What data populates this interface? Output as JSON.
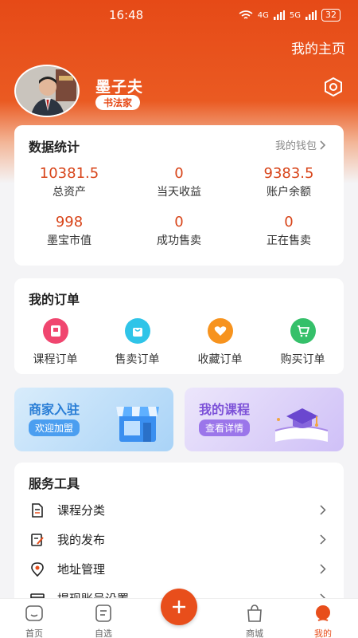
{
  "status": {
    "time": "16:48",
    "battery": "32",
    "signal1": "4G",
    "signal2": "5G"
  },
  "header": {
    "homepage_link": "我的主页"
  },
  "profile": {
    "name": "墨子夫",
    "badge": "书法家"
  },
  "stats": {
    "title": "数据统计",
    "wallet_link": "我的钱包",
    "items": [
      {
        "value": "10381.5",
        "label": "总资产"
      },
      {
        "value": "0",
        "label": "当天收益"
      },
      {
        "value": "9383.5",
        "label": "账户余额"
      },
      {
        "value": "998",
        "label": "墨宝市值"
      },
      {
        "value": "0",
        "label": "成功售卖"
      },
      {
        "value": "0",
        "label": "正在售卖"
      }
    ]
  },
  "orders": {
    "title": "我的订单",
    "items": [
      {
        "label": "课程订单",
        "icon": "book-icon",
        "color": "#f0466f"
      },
      {
        "label": "售卖订单",
        "icon": "shopping-bag-icon",
        "color": "#2fc4e8"
      },
      {
        "label": "收藏订单",
        "icon": "heart-icon",
        "color": "#f7931e"
      },
      {
        "label": "购买订单",
        "icon": "cart-icon",
        "color": "#35c06a"
      }
    ]
  },
  "promos": {
    "merchant": {
      "title": "商家入驻",
      "pill": "欢迎加盟"
    },
    "course": {
      "title": "我的课程",
      "pill": "查看详情"
    }
  },
  "tools": {
    "title": "服务工具",
    "items": [
      {
        "label": "课程分类",
        "icon": "document-icon"
      },
      {
        "label": "我的发布",
        "icon": "edit-icon"
      },
      {
        "label": "地址管理",
        "icon": "location-icon"
      },
      {
        "label": "提现账号设置",
        "icon": "card-icon"
      }
    ]
  },
  "tabbar": {
    "items": [
      {
        "label": "首页",
        "icon": "home-icon"
      },
      {
        "label": "自选",
        "icon": "list-icon"
      },
      {
        "label": "商城",
        "icon": "bag-icon"
      },
      {
        "label": "我的",
        "icon": "user-icon"
      }
    ],
    "active_color": "#e84e1b"
  }
}
